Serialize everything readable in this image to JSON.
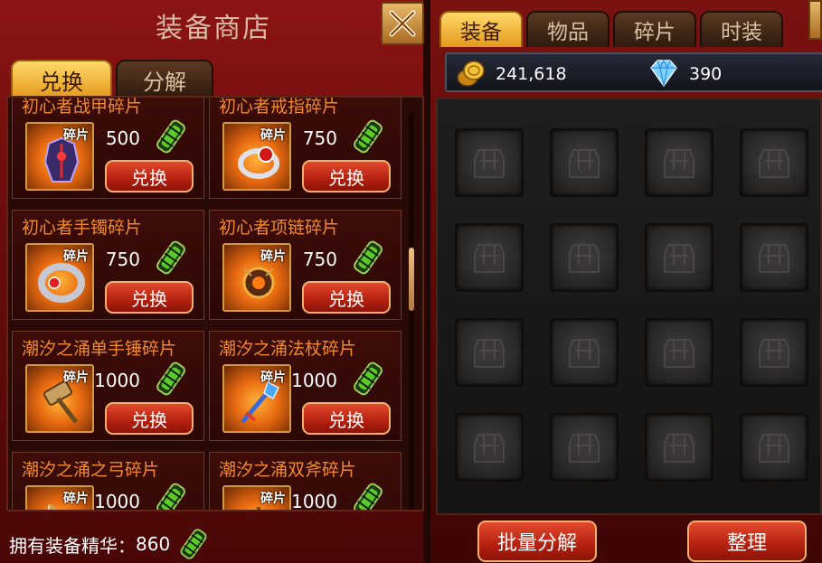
{
  "shop": {
    "title": "装备商店",
    "tabs": [
      {
        "label": "兑换",
        "active": true
      },
      {
        "label": "分解",
        "active": false
      }
    ],
    "item_tag": "碎片",
    "exchange_label": "兑换",
    "items": [
      {
        "name": "初心者战甲碎片",
        "cost": "500",
        "icon": "armor-icon"
      },
      {
        "name": "初心者戒指碎片",
        "cost": "750",
        "icon": "ring-icon"
      },
      {
        "name": "初心者手镯碎片",
        "cost": "750",
        "icon": "bracelet-icon"
      },
      {
        "name": "初心者项链碎片",
        "cost": "750",
        "icon": "necklace-icon"
      },
      {
        "name": "潮汐之涌单手锤碎片",
        "cost": "1000",
        "icon": "hammer-icon"
      },
      {
        "name": "潮汐之涌法杖碎片",
        "cost": "1000",
        "icon": "staff-icon"
      },
      {
        "name": "潮汐之涌之弓碎片",
        "cost": "1000",
        "icon": "bow-icon"
      },
      {
        "name": "潮汐之涌双斧碎片",
        "cost": "1000",
        "icon": "axe-icon"
      }
    ],
    "footer": {
      "label": "拥有装备精华：",
      "value": "860"
    }
  },
  "inventory": {
    "tabs": [
      {
        "label": "装备",
        "active": true
      },
      {
        "label": "物品",
        "active": false
      },
      {
        "label": "碎片",
        "active": false
      },
      {
        "label": "时装",
        "active": false
      }
    ],
    "gold": "241,618",
    "diamonds": "390",
    "empty_slots": 16,
    "buttons": {
      "bulk_decompose": "批量分解",
      "sort": "整理"
    }
  },
  "colors": {
    "accent_gold": "#e49a1c",
    "button_red": "#b4200f",
    "item_name": "#f08a2e",
    "essence_green": "#5acb2a"
  }
}
